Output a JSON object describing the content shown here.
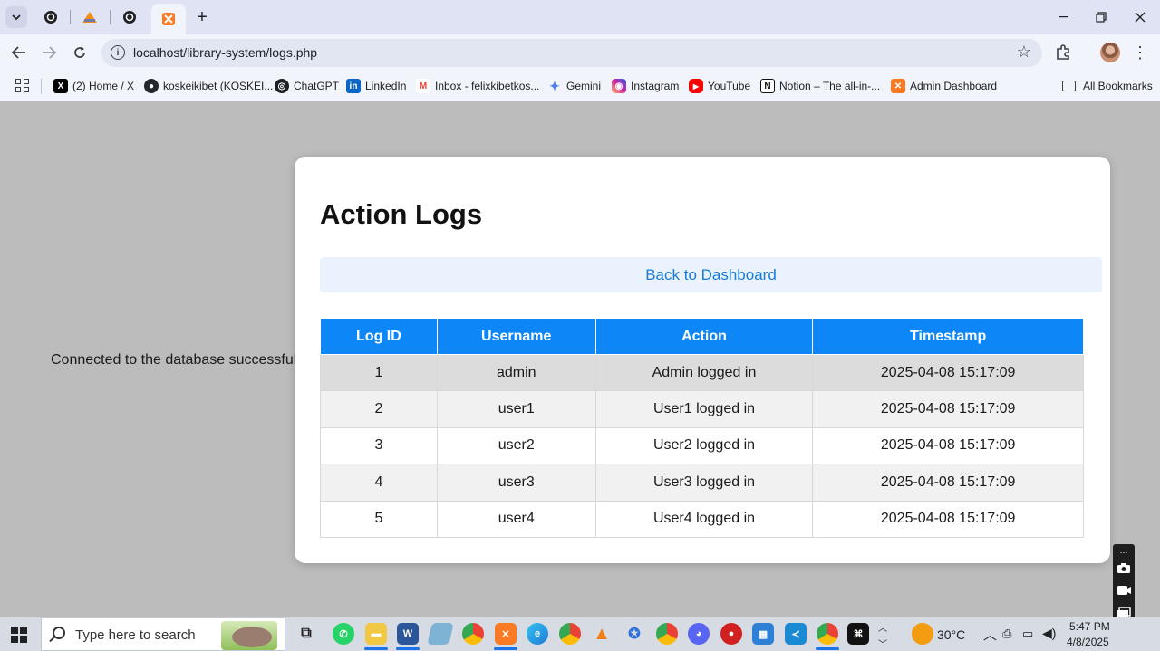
{
  "browser": {
    "address": "localhost/library-system/logs.php",
    "bookmarks": [
      {
        "label": "(2) Home / X",
        "icon": "x-icon",
        "color": "#000000"
      },
      {
        "label": "koskeikibet (KOSKEI...",
        "icon": "github-icon",
        "color": "#24292f"
      },
      {
        "label": "ChatGPT",
        "icon": "chatgpt-icon",
        "color": "#202124"
      },
      {
        "label": "LinkedIn",
        "icon": "linkedin-icon",
        "color": "#0a66c2"
      },
      {
        "label": "Inbox - felixkibetkos...",
        "icon": "gmail-icon",
        "color": "#ea4335"
      },
      {
        "label": "Gemini",
        "icon": "gemini-icon",
        "color": "#4e7df1"
      },
      {
        "label": "Instagram",
        "icon": "instagram-icon",
        "color": "#d6249f"
      },
      {
        "label": "YouTube",
        "icon": "youtube-icon",
        "color": "#ff0000"
      },
      {
        "label": "Notion – The all-in-...",
        "icon": "notion-icon",
        "color": "#111111"
      },
      {
        "label": "Admin Dashboard",
        "icon": "xampp-icon",
        "color": "#fb7a24"
      }
    ],
    "all_bookmarks": "All Bookmarks"
  },
  "page": {
    "db_message": "Connected to the database successfully!",
    "title": "Action Logs",
    "back_link": "Back to Dashboard",
    "table": {
      "headers": [
        "Log ID",
        "Username",
        "Action",
        "Timestamp"
      ],
      "rows": [
        [
          "1",
          "admin",
          "Admin logged in",
          "2025-04-08 15:17:09"
        ],
        [
          "2",
          "user1",
          "User1 logged in",
          "2025-04-08 15:17:09"
        ],
        [
          "3",
          "user2",
          "User2 logged in",
          "2025-04-08 15:17:09"
        ],
        [
          "4",
          "user3",
          "User3 logged in",
          "2025-04-08 15:17:09"
        ],
        [
          "5",
          "user4",
          "User4 logged in",
          "2025-04-08 15:17:09"
        ]
      ]
    }
  },
  "taskbar": {
    "search_placeholder": "Type here to search",
    "weather": "30°C",
    "time": "5:47 PM",
    "date": "4/8/2025"
  }
}
